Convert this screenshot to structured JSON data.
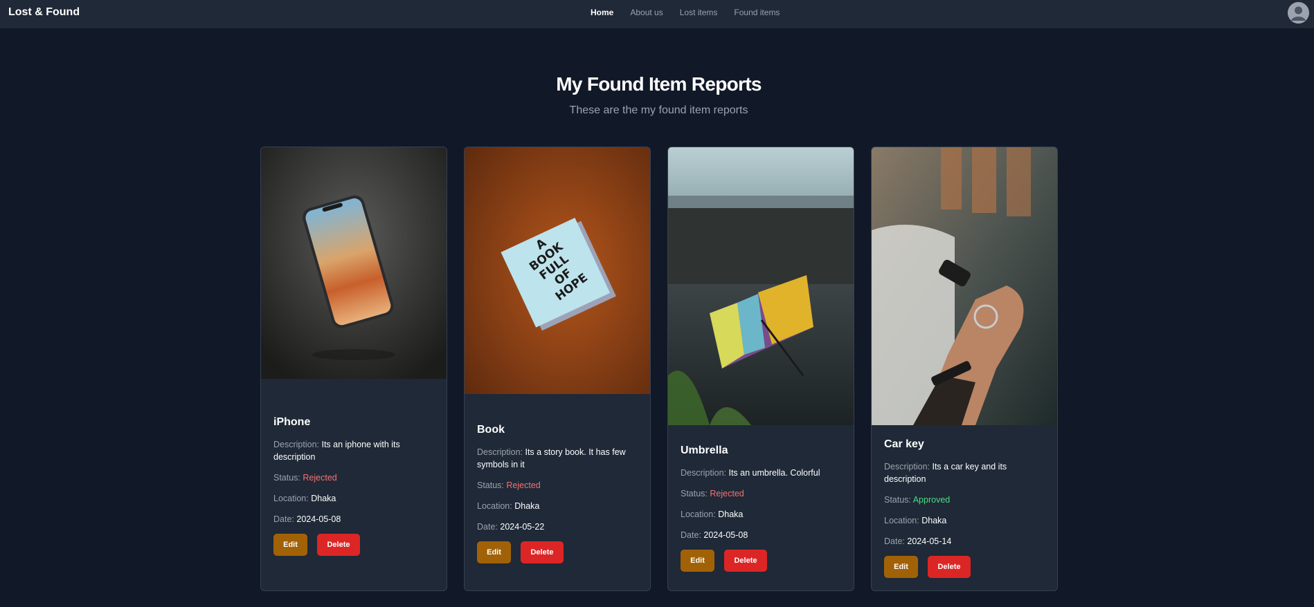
{
  "nav": {
    "brand": "Lost & Found",
    "links": [
      "Home",
      "About us",
      "Lost items",
      "Found items"
    ]
  },
  "header": {
    "title": "My Found Item Reports",
    "subtitle": "These are the my found item reports"
  },
  "labels": {
    "description": "Description:",
    "status": "Status:",
    "location": "Location:",
    "date": "Date:",
    "edit": "Edit",
    "delete": "Delete"
  },
  "cards": [
    {
      "title": "iPhone",
      "description": "Its an iphone with its description",
      "status": "Rejected",
      "location": "Dhaka",
      "date": "2024-05-08",
      "image": "phone-photo"
    },
    {
      "title": "Book",
      "description": "Its a story book. It has few symbols in it",
      "status": "Rejected",
      "location": "Dhaka",
      "date": "2024-05-22",
      "image": "book-photo",
      "image_text": "A BOOK FULL OF HOPE"
    },
    {
      "title": "Umbrella",
      "description": "Its an umbrella. Colorful",
      "status": "Rejected",
      "location": "Dhaka",
      "date": "2024-05-08",
      "image": "umbrella-photo"
    },
    {
      "title": "Car key",
      "description": "Its a car key and its description",
      "status": "Approved",
      "location": "Dhaka",
      "date": "2024-05-14",
      "image": "car-key-photo"
    }
  ],
  "colors": {
    "background": "#111827",
    "card": "#1f2937",
    "rejected": "#f87171",
    "approved": "#4ade80",
    "edit_button": "#a16207",
    "delete_button": "#dc2626"
  }
}
